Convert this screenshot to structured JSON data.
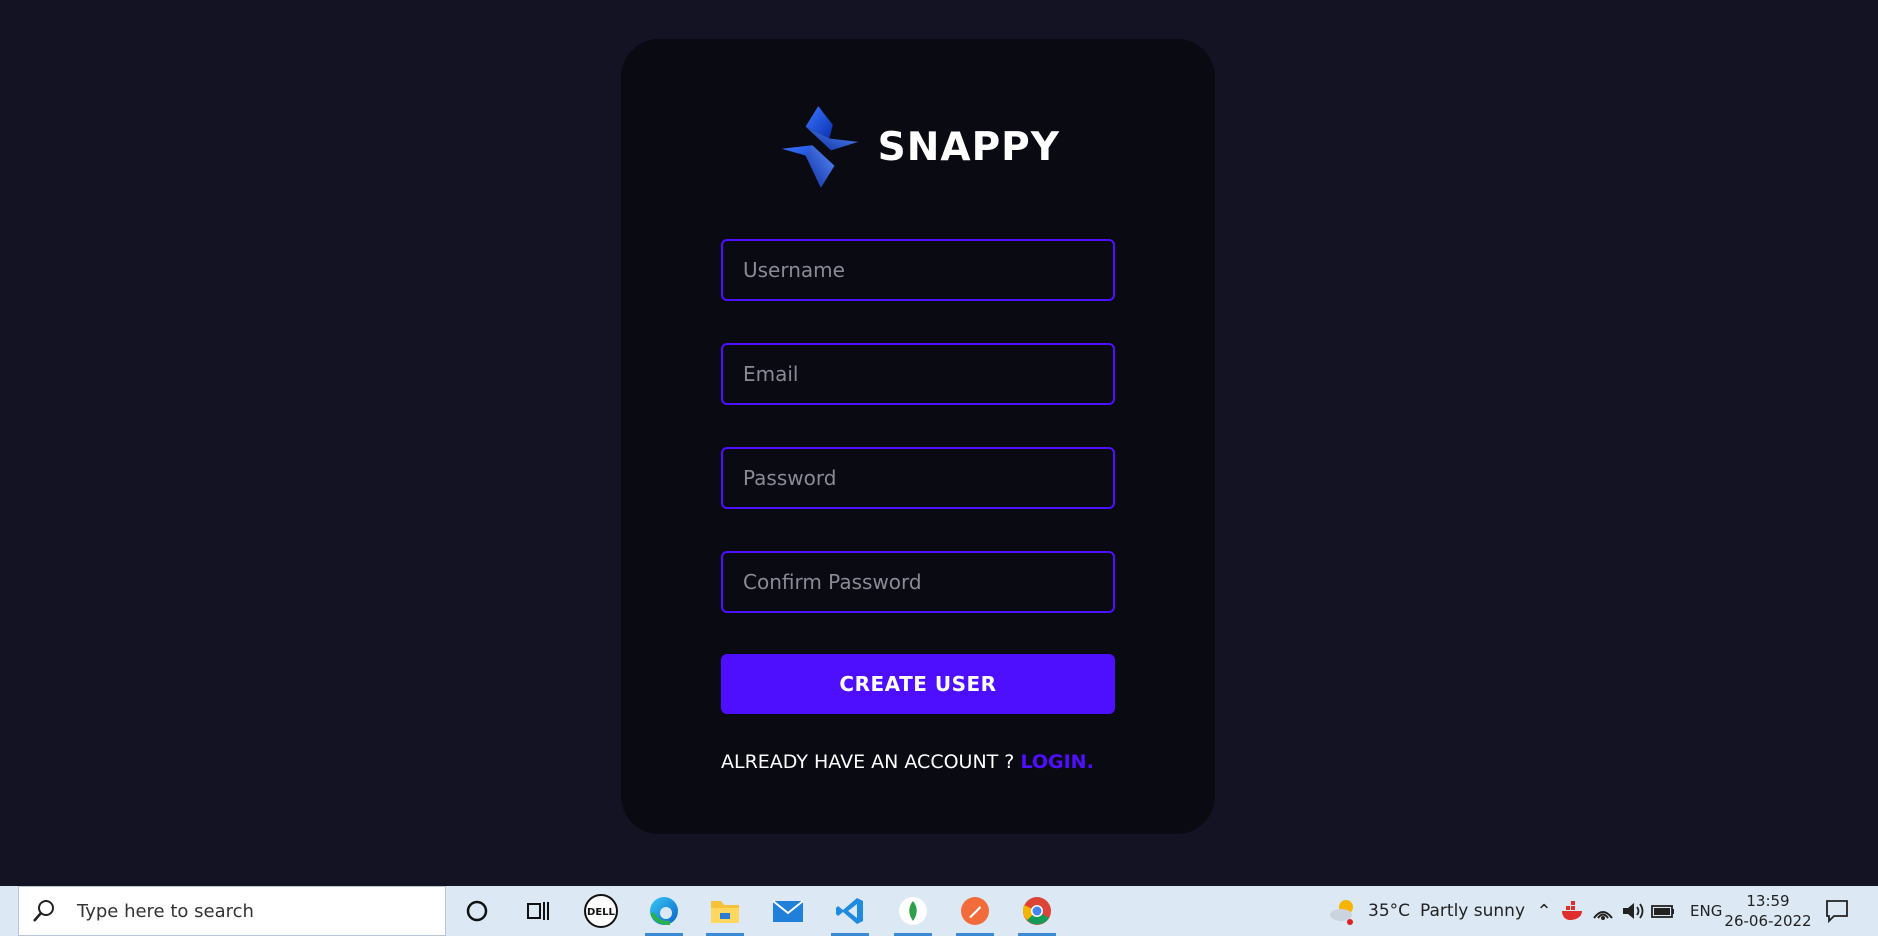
{
  "brand": {
    "name": "SNAPPY"
  },
  "form": {
    "username_placeholder": "Username",
    "email_placeholder": "Email",
    "password_placeholder": "Password",
    "confirm_placeholder": "Confirm Password",
    "submit_label": "CREATE USER",
    "footer_text": "ALREADY HAVE AN ACCOUNT ? ",
    "footer_link": "LOGIN."
  },
  "taskbar": {
    "search_placeholder": "Type here to search",
    "weather_temp": "35°C",
    "weather_desc": "Partly sunny",
    "language": "ENG",
    "time": "13:59",
    "date": "26-06-2022",
    "apps": [
      "cortana-icon",
      "task-view-icon",
      "dell-icon",
      "edge-icon",
      "file-explorer-icon",
      "mail-icon",
      "vscode-icon",
      "mongodb-icon",
      "postman-icon",
      "chrome-icon"
    ]
  },
  "colors": {
    "accent": "#4e0eff",
    "page_bg": "#131324",
    "card_bg": "#0a0a13"
  }
}
